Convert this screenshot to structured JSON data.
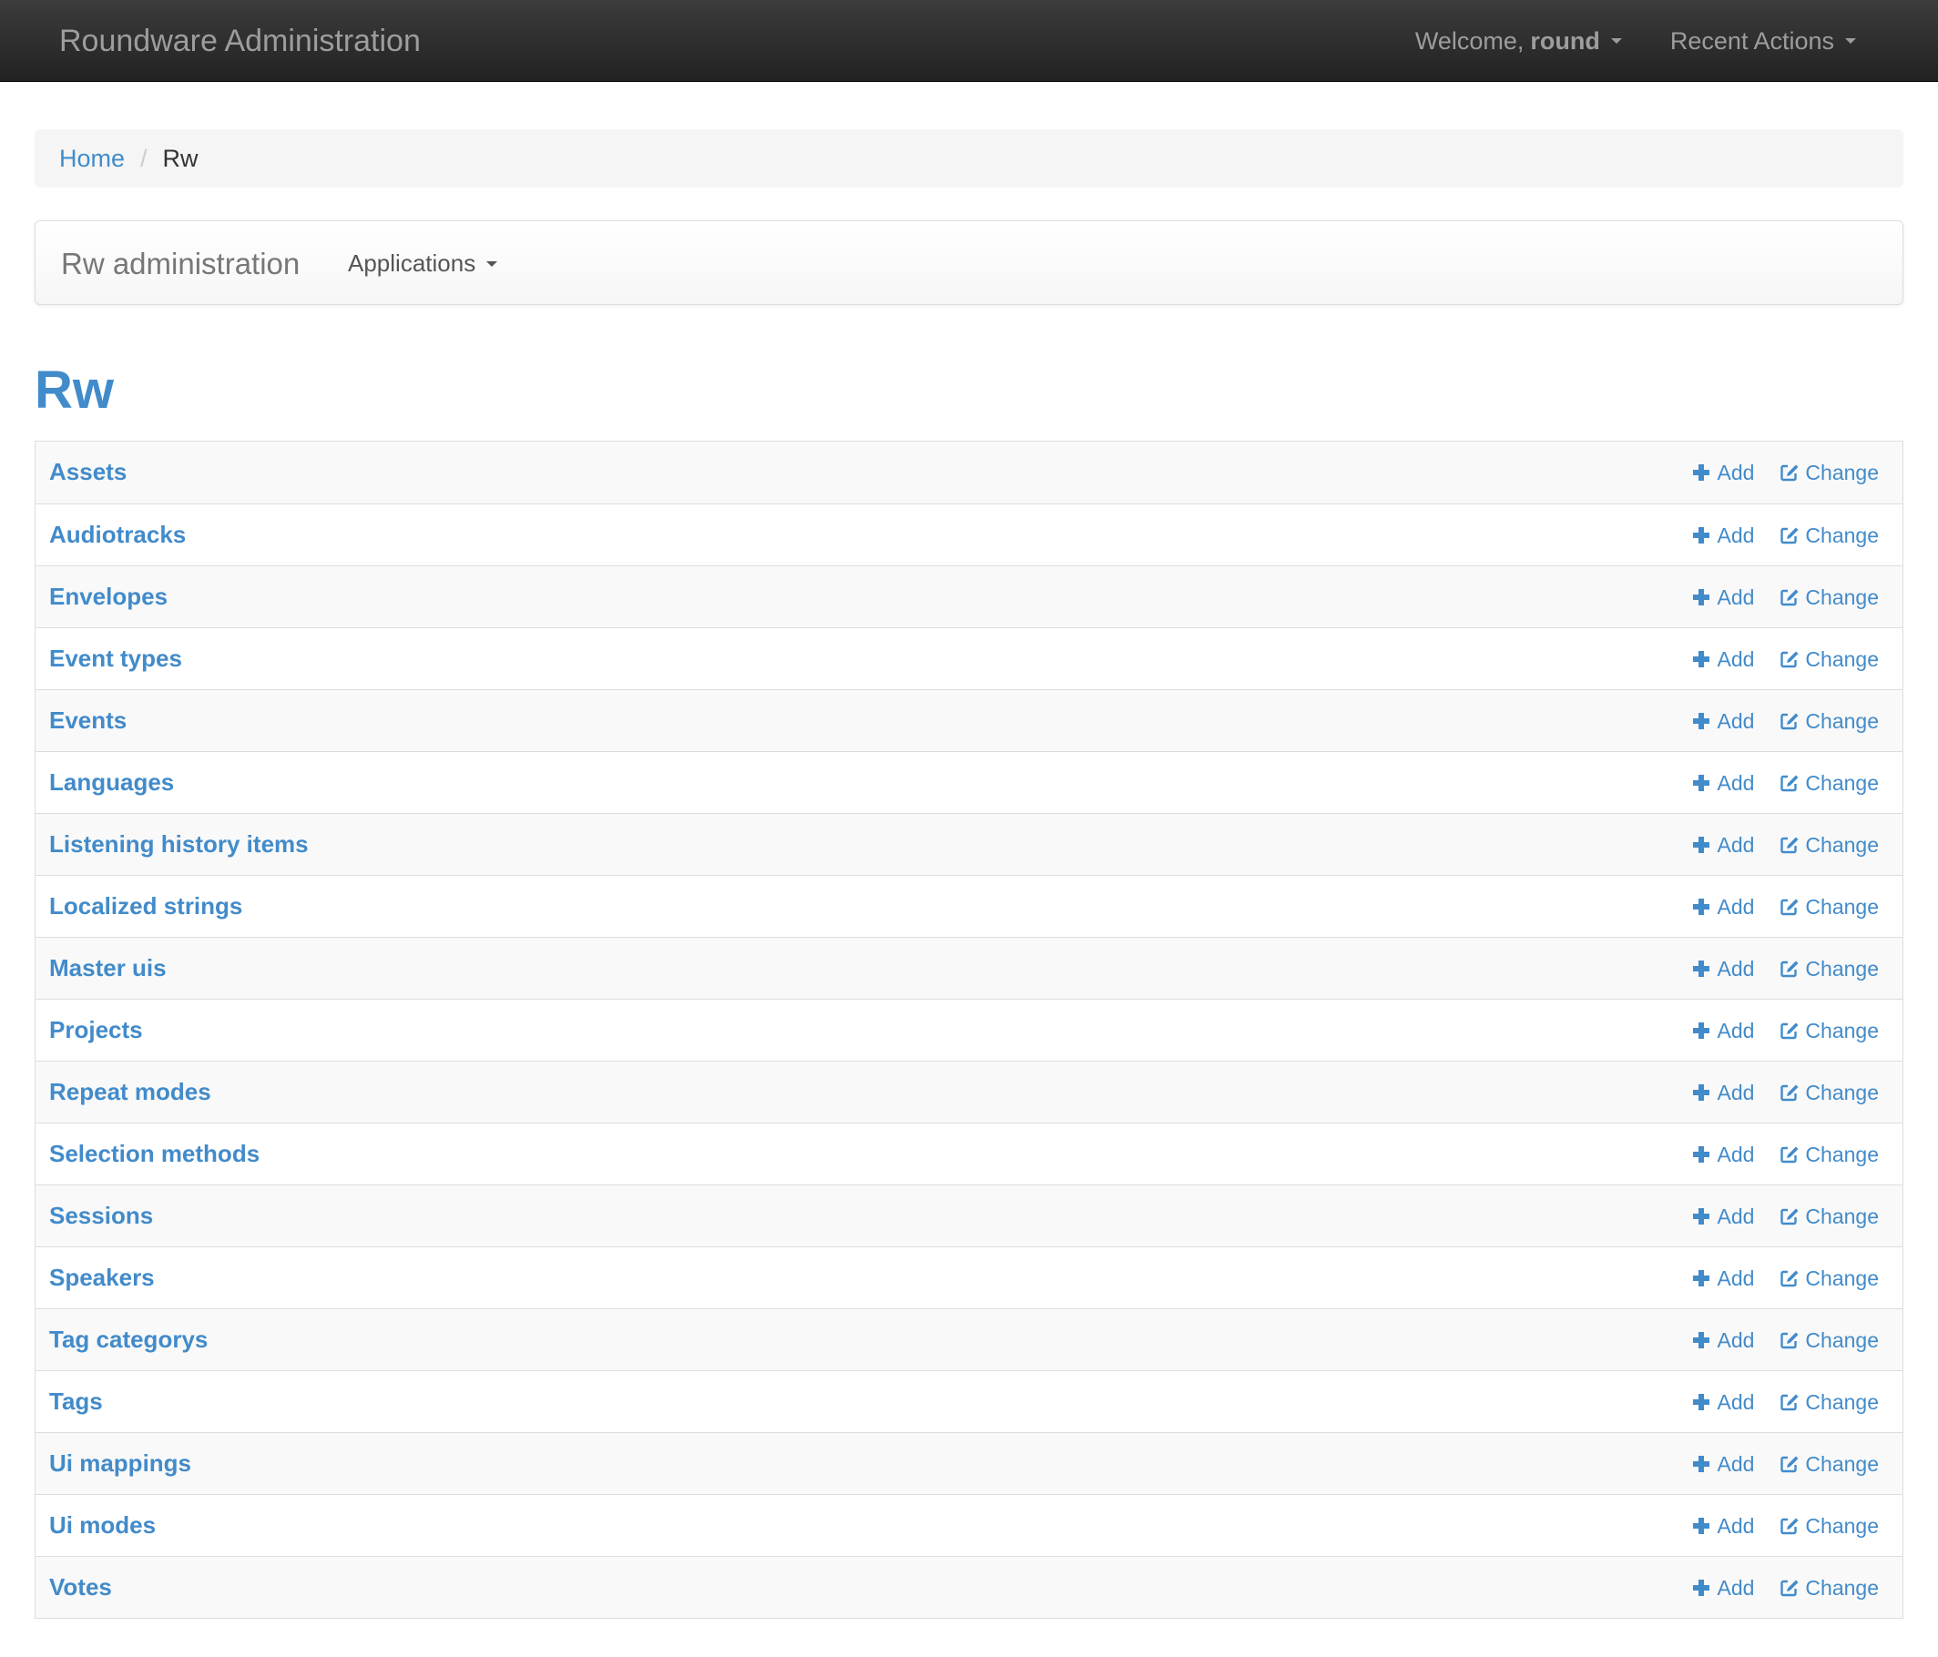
{
  "app": {
    "brand": "Roundware Administration",
    "welcome_prefix": "Welcome,",
    "username": "round",
    "recent_actions": "Recent Actions"
  },
  "breadcrumb": {
    "home": "Home",
    "separator": "/",
    "current": "Rw"
  },
  "subnav": {
    "title": "Rw administration",
    "applications": "Applications"
  },
  "page": {
    "heading": "Rw"
  },
  "actions": {
    "add_label": "Add",
    "change_label": "Change"
  },
  "models": [
    "Assets",
    "Audiotracks",
    "Envelopes",
    "Event types",
    "Events",
    "Languages",
    "Listening history items",
    "Localized strings",
    "Master uis",
    "Projects",
    "Repeat modes",
    "Selection methods",
    "Sessions",
    "Speakers",
    "Tag categorys",
    "Tags",
    "Ui mappings",
    "Ui modes",
    "Votes"
  ],
  "colors": {
    "accent": "#428bca",
    "topbar": "#222222",
    "topbar_text": "#9d9d9d",
    "row_stripe": "#f9f9f9",
    "border": "#dddddd"
  },
  "icons": {
    "add": "plus-icon",
    "change": "edit-icon",
    "dropdown": "caret-down-icon"
  }
}
